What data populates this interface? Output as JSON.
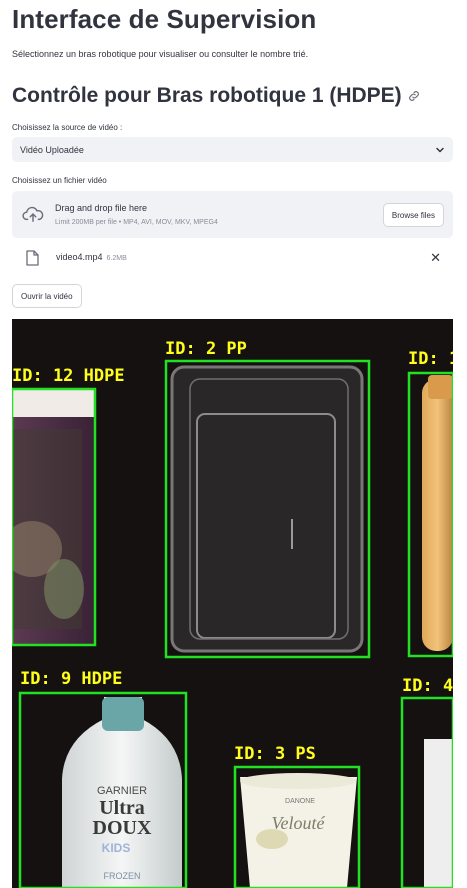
{
  "page": {
    "title": "Interface de Supervision",
    "subtitle": "Sélectionnez un bras robotique pour visualiser ou consulter le nombre trié."
  },
  "section": {
    "heading": "Contrôle pour Bras robotique 1 (HDPE)"
  },
  "source_select": {
    "label": "Choisissez la source de vidéo :",
    "value": "Vidéo Uploadée"
  },
  "uploader": {
    "label": "Choisissez un fichier vidéo",
    "drop_text": "Drag and drop file here",
    "limit_text": "Limit 200MB per file • MP4, AVI, MOV, MKV, MPEG4",
    "browse_label": "Browse files"
  },
  "uploaded_file": {
    "name": "video4.mp4",
    "size": "6.2MB"
  },
  "open_button": {
    "label": "Ouvrir la vidéo"
  },
  "video": {
    "detections": [
      {
        "label": "ID: 12 HDPE"
      },
      {
        "label": "ID: 2 PP"
      },
      {
        "label": "ID: 1"
      },
      {
        "label": "ID: 9 HDPE"
      },
      {
        "label": "ID: 3 PS"
      },
      {
        "label": "ID: 4"
      }
    ],
    "box_color": "#22e022",
    "label_color": "#ffff1a",
    "product_texts": {
      "garnier": "GARNIER",
      "ultra": "Ultra",
      "doux": "DOUX",
      "kids": "KIDS",
      "frozen": "FROZEN",
      "danone": "DANONE",
      "velouté": "Velouté"
    }
  }
}
